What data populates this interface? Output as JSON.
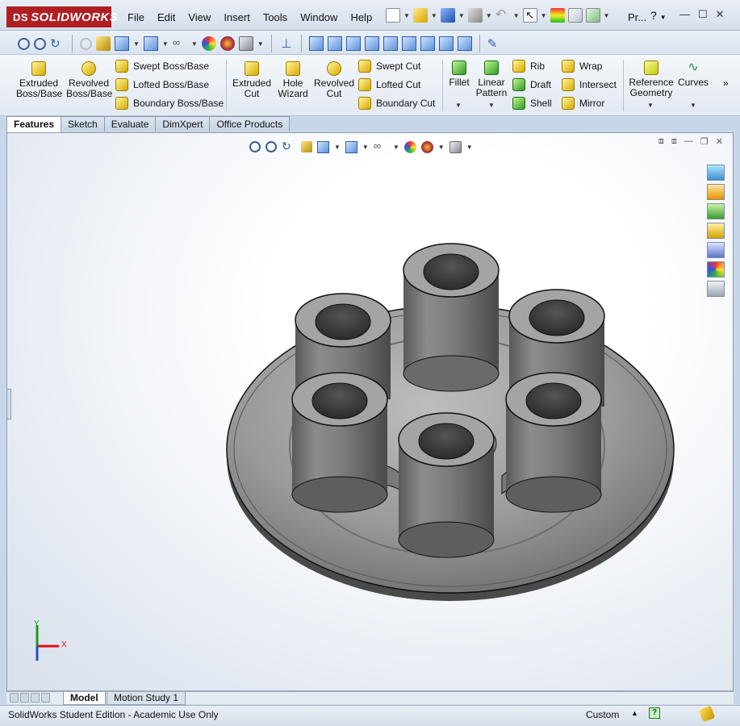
{
  "app": {
    "brand": "SOLIDWORKS",
    "brand_prefix": "DS"
  },
  "menu": [
    "File",
    "Edit",
    "View",
    "Insert",
    "Tools",
    "Window",
    "Help"
  ],
  "search": {
    "label": "Pr..."
  },
  "command_manager": {
    "extruded_boss": "Extruded\nBoss/Base",
    "revolved_boss": "Revolved\nBoss/Base",
    "swept_boss": "Swept Boss/Base",
    "lofted_boss": "Lofted Boss/Base",
    "boundary_boss": "Boundary Boss/Base",
    "extruded_cut": "Extruded\nCut",
    "hole_wizard": "Hole\nWizard",
    "revolved_cut": "Revolved\nCut",
    "swept_cut": "Swept Cut",
    "lofted_cut": "Lofted Cut",
    "boundary_cut": "Boundary Cut",
    "fillet": "Fillet",
    "linear_pattern": "Linear\nPattern",
    "rib": "Rib",
    "draft": "Draft",
    "shell": "Shell",
    "wrap": "Wrap",
    "intersect": "Intersect",
    "mirror": "Mirror",
    "reference_geometry": "Reference\nGeometry",
    "curves": "Curves"
  },
  "tabs": [
    "Features",
    "Sketch",
    "Evaluate",
    "DimXpert",
    "Office Products"
  ],
  "bottom_tabs": [
    "Model",
    "Motion Study 1"
  ],
  "status": {
    "text": "SolidWorks Student Edition - Academic Use Only",
    "units": "Custom"
  },
  "triad": {
    "x": "X",
    "y": "Y"
  },
  "colors": {
    "brand_red": "#b01e22",
    "part_gray": "#8a8a8a",
    "feature_yellow": "#e8c400"
  }
}
